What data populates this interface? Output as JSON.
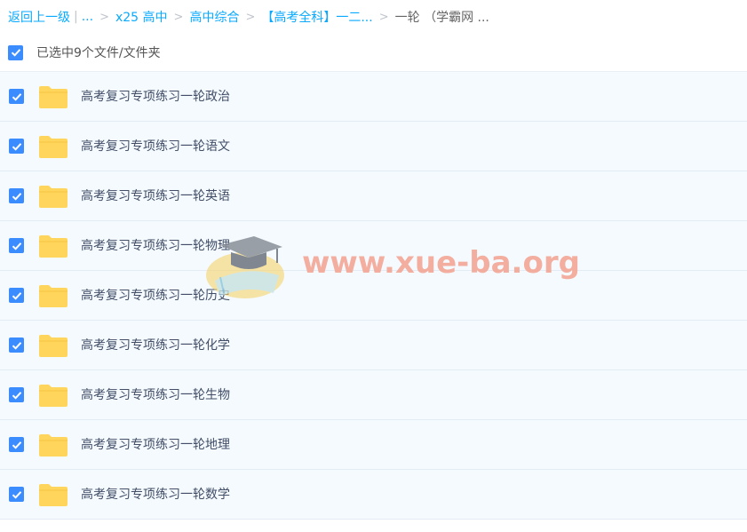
{
  "breadcrumb": {
    "back": "返回上一级",
    "ellipsis": "...",
    "items": [
      "x25 高中",
      "高中综合",
      "【高考全科】一二..."
    ],
    "current": "一轮 （学霸网 ..."
  },
  "select_all_label": "已选中9个文件/文件夹",
  "files": [
    {
      "name": "高考复习专项练习一轮政治",
      "checked": true
    },
    {
      "name": "高考复习专项练习一轮语文",
      "checked": true
    },
    {
      "name": "高考复习专项练习一轮英语",
      "checked": true
    },
    {
      "name": "高考复习专项练习一轮物理",
      "checked": true
    },
    {
      "name": "高考复习专项练习一轮历史",
      "checked": true
    },
    {
      "name": "高考复习专项练习一轮化学",
      "checked": true
    },
    {
      "name": "高考复习专项练习一轮生物",
      "checked": true
    },
    {
      "name": "高考复习专项练习一轮地理",
      "checked": true
    },
    {
      "name": "高考复习专项练习一轮数学",
      "checked": true
    }
  ],
  "watermark": {
    "text": "www.xue-ba.org"
  },
  "colors": {
    "link": "#09aaff",
    "checkbox": "#3b8cff",
    "folder": "#ffd55c",
    "row_bg": "#f4fafe",
    "watermark": "#f3a18f"
  },
  "icons": {
    "checkbox": "check-icon",
    "folder": "folder-icon",
    "watermark_logo": "graduation-cap-book-logo"
  }
}
